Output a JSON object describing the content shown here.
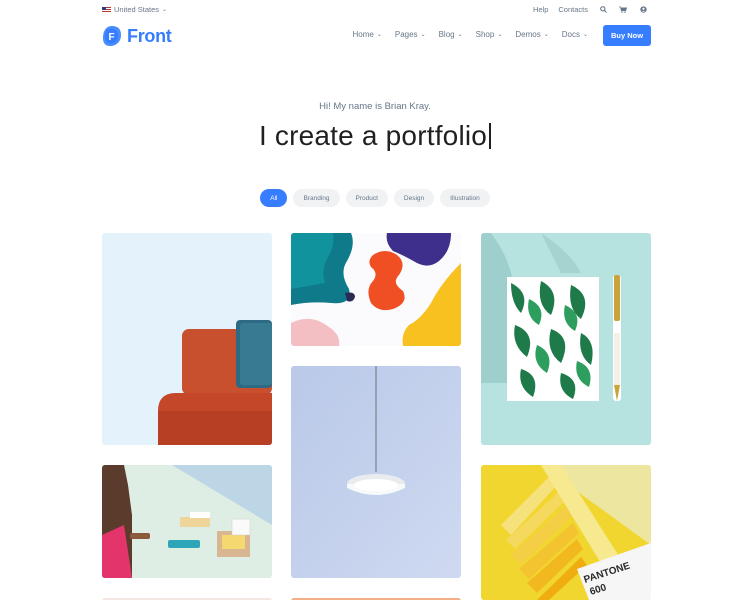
{
  "topbar": {
    "locale": "United States",
    "links": [
      "Help",
      "Contacts"
    ]
  },
  "brand": {
    "name": "Front",
    "color": "#377dff"
  },
  "nav": {
    "items": [
      "Home",
      "Pages",
      "Blog",
      "Shop",
      "Demos",
      "Docs"
    ],
    "cta": "Buy Now"
  },
  "hero": {
    "greeting": "Hi! My name is Brian Kray.",
    "headline": "I create a portfolio"
  },
  "filters": {
    "items": [
      "All",
      "Branding",
      "Product",
      "Design",
      "Illustration"
    ],
    "active": "All"
  },
  "gallery": {
    "pantone_brand": "PANTONE",
    "pantone_code": "600"
  },
  "icons": [
    "search-icon",
    "cart-icon",
    "user-icon",
    "chevron-down-icon"
  ]
}
